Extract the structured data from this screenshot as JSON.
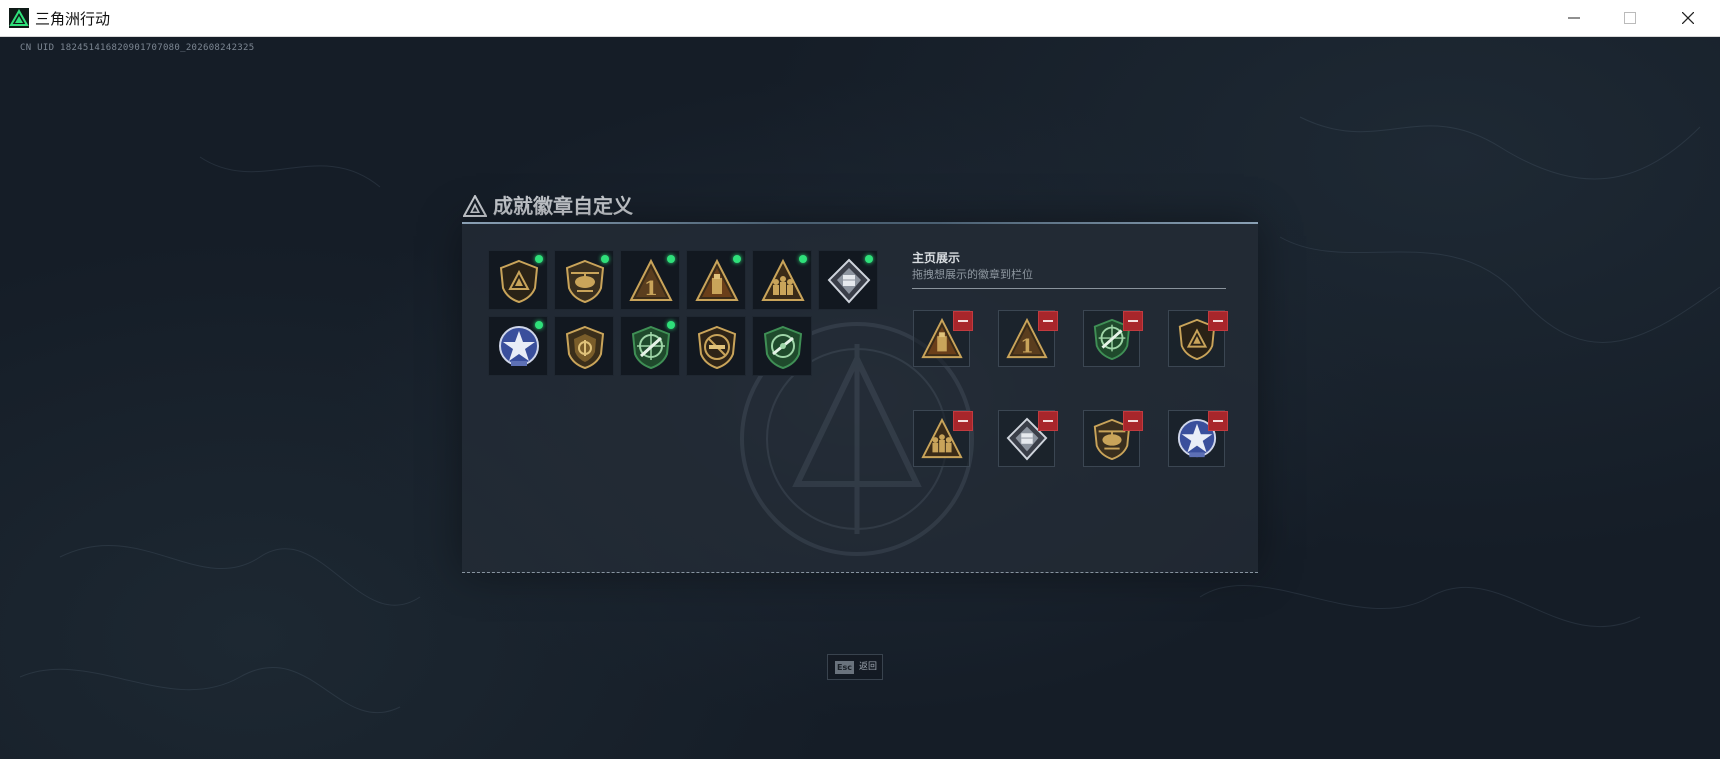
{
  "window": {
    "title": "三角洲行动",
    "minimize_icon": "minimize-icon",
    "maximize_icon": "maximize-icon",
    "close_icon": "close-icon"
  },
  "uid": "CN UID 182451416820901707080_202608242325",
  "dialog": {
    "title": "成就徽章自定义",
    "title_icon": "delta-triangle-icon"
  },
  "badges": [
    {
      "icon": "gold-shield-triangle-badge",
      "new": true
    },
    {
      "icon": "gold-helicopter-badge",
      "new": true
    },
    {
      "icon": "gold-triangle-number-one-badge",
      "new": true
    },
    {
      "icon": "gold-triangle-ammo-badge",
      "new": true
    },
    {
      "icon": "gold-triangle-squad-badge",
      "new": true
    },
    {
      "icon": "silver-diamond-crate-badge",
      "new": true
    },
    {
      "icon": "blue-star-badge",
      "new": true
    },
    {
      "icon": "gold-shield-emblem-badge",
      "new": false
    },
    {
      "icon": "green-crosshair-rifle-badge",
      "new": true
    },
    {
      "icon": "gold-no-weapon-badge",
      "new": false
    },
    {
      "icon": "green-crosshair-shield-badge",
      "new": false
    }
  ],
  "display": {
    "title": "主页展示",
    "subtitle": "拖拽想展示的徽章到栏位",
    "remove_icon": "remove-icon",
    "slots": [
      "gold-triangle-ammo-badge",
      "gold-triangle-number-one-badge",
      "green-crosshair-rifle-badge",
      "gold-shield-triangle-badge",
      "gold-triangle-squad-badge",
      "silver-diamond-crate-badge",
      "gold-helicopter-badge",
      "blue-star-badge"
    ]
  },
  "footer": {
    "esc_key": "Esc",
    "esc_label": "返回"
  },
  "colors": {
    "accent_green": "#2fe07a",
    "remove_red": "#a8262b",
    "gold": "#c9a45a",
    "badge_green": "#3f8f55",
    "badge_blue": "#3a4f9c"
  }
}
